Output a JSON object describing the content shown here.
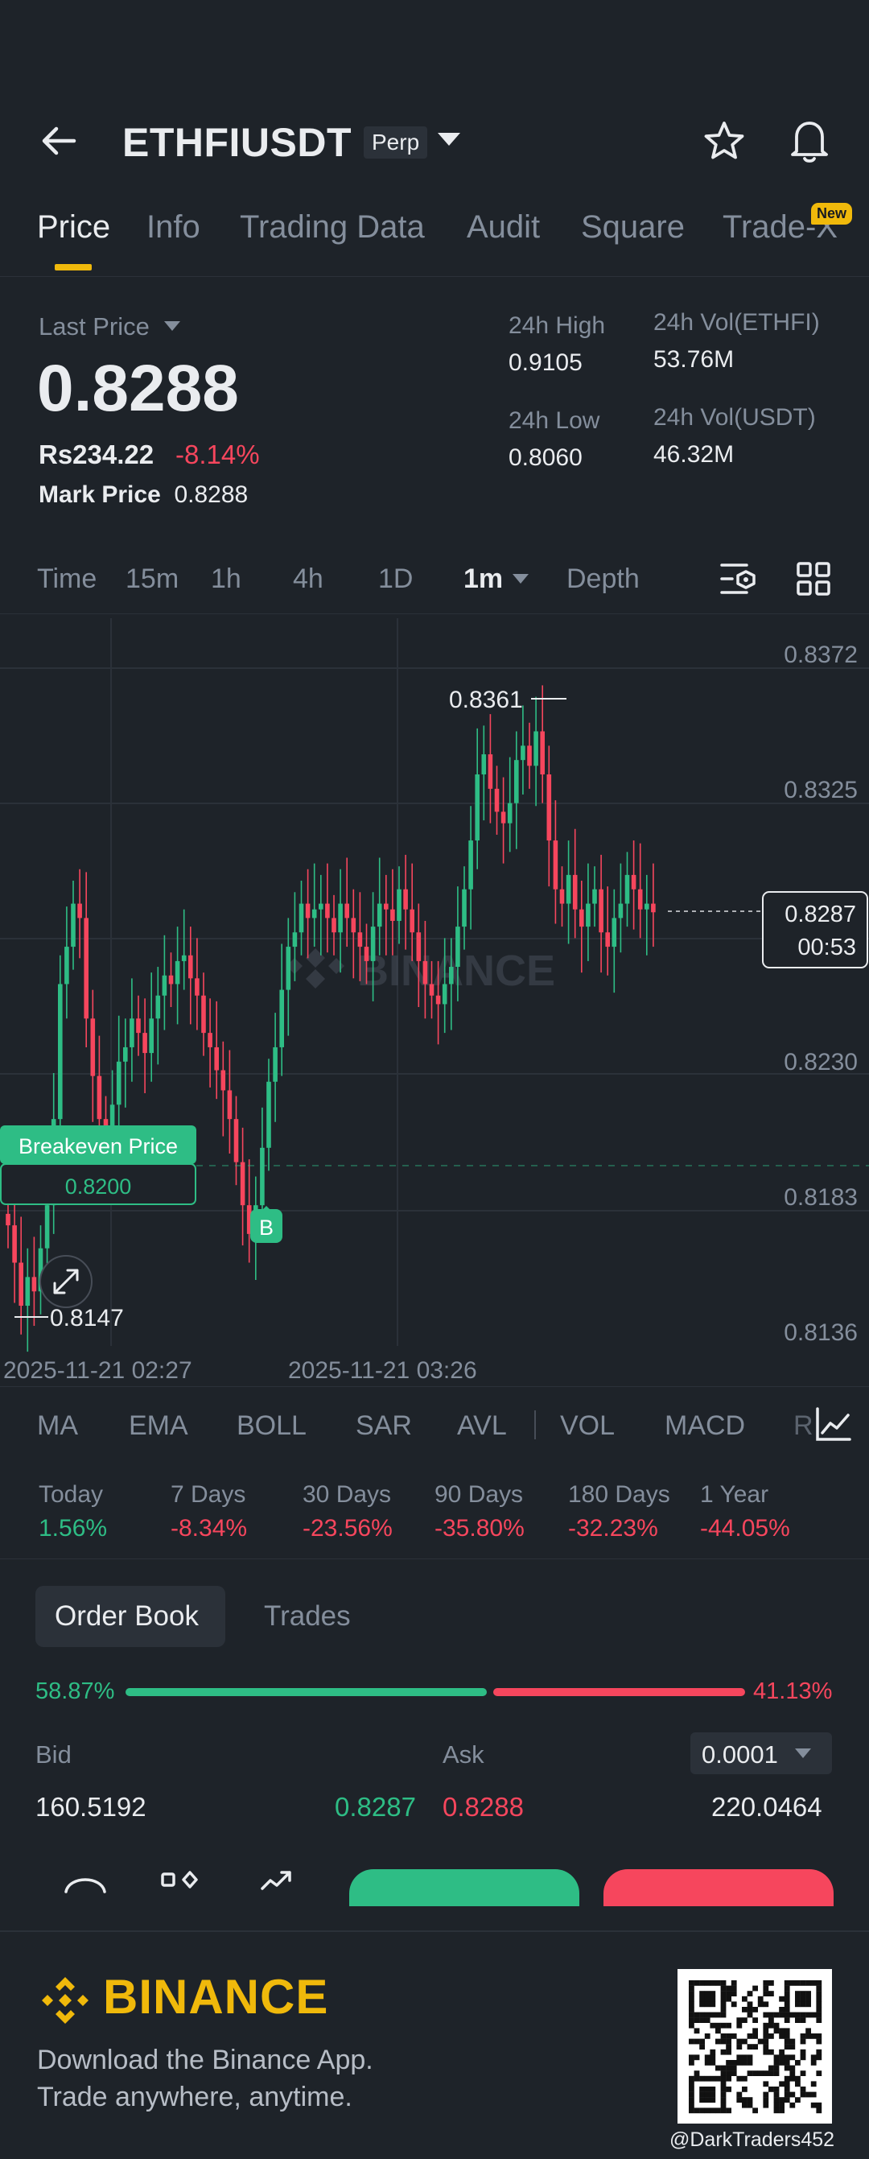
{
  "header": {
    "symbol": "ETHFIUSDT",
    "contract_type": "Perp"
  },
  "tabs": [
    {
      "label": "Price",
      "active": true
    },
    {
      "label": "Info"
    },
    {
      "label": "Trading Data"
    },
    {
      "label": "Audit"
    },
    {
      "label": "Square"
    },
    {
      "label": "Trade-X",
      "badge": "New"
    }
  ],
  "price": {
    "last_price_label": "Last Price",
    "last_price": "0.8288",
    "local_price": "Rs234.22",
    "change_pct": "-8.14%",
    "mark_price_label": "Mark Price",
    "mark_price": "0.8288"
  },
  "stats": {
    "high_label": "24h High",
    "high": "0.9105",
    "low_label": "24h Low",
    "low": "0.8060",
    "vol_base_label": "24h Vol(ETHFI)",
    "vol_base": "53.76M",
    "vol_quote_label": "24h Vol(USDT)",
    "vol_quote": "46.32M"
  },
  "intervals": [
    "Time",
    "15m",
    "1h",
    "4h",
    "1D",
    "1m",
    "Depth"
  ],
  "active_interval": "1m",
  "chart_data": {
    "type": "candlestick",
    "y_ticks": [
      "0.8372",
      "0.8325",
      "0.8230",
      "0.8183",
      "0.8136"
    ],
    "ylim": [
      0.8136,
      0.8372
    ],
    "x_ticks": [
      "2025-11-21 02:27",
      "2025-11-21 03:26"
    ],
    "high_marker": "0.8361",
    "low_marker": "0.8147",
    "current_price": "0.8287",
    "countdown": "00:53",
    "breakeven_label": "Breakeven Price",
    "breakeven_price": "0.8200",
    "buy_marker": "B",
    "watermark": "BINANCE",
    "up_color": "#2ebd85",
    "down_color": "#f6465d",
    "closes": [
      0.8178,
      0.8165,
      0.815,
      0.816,
      0.8155,
      0.817,
      0.8185,
      0.8215,
      0.8262,
      0.8275,
      0.829,
      0.8285,
      0.825,
      0.823,
      0.8215,
      0.8212,
      0.822,
      0.8235,
      0.824,
      0.825,
      0.8245,
      0.8238,
      0.825,
      0.8258,
      0.8265,
      0.8262,
      0.827,
      0.8272,
      0.8264,
      0.8258,
      0.8245,
      0.824,
      0.8232,
      0.8225,
      0.8215,
      0.82,
      0.8185,
      0.8175,
      0.8185,
      0.8205,
      0.8228,
      0.824,
      0.826,
      0.8275,
      0.828,
      0.829,
      0.8285,
      0.8288,
      0.829,
      0.8285,
      0.828,
      0.829,
      0.8285,
      0.828,
      0.8275,
      0.827,
      0.8282,
      0.829,
      0.8288,
      0.8284,
      0.8295,
      0.8288,
      0.828,
      0.827,
      0.8262,
      0.8258,
      0.8255,
      0.8262,
      0.8268,
      0.8282,
      0.8295,
      0.8312,
      0.8335,
      0.8342,
      0.833,
      0.8322,
      0.8318,
      0.8325,
      0.834,
      0.8345,
      0.8338,
      0.835,
      0.8335,
      0.8312,
      0.8295,
      0.829,
      0.83,
      0.8288,
      0.8282,
      0.829,
      0.8295,
      0.828,
      0.8275,
      0.8285,
      0.829,
      0.83,
      0.8295,
      0.8288,
      0.829,
      0.8287
    ]
  },
  "indicators": [
    "MA",
    "EMA",
    "BOLL",
    "SAR",
    "AVL",
    "VOL",
    "MACD",
    "R"
  ],
  "performance": [
    {
      "label": "Today",
      "value": "1.56%",
      "dir": "up"
    },
    {
      "label": "7 Days",
      "value": "-8.34%",
      "dir": "down"
    },
    {
      "label": "30 Days",
      "value": "-23.56%",
      "dir": "down"
    },
    {
      "label": "90 Days",
      "value": "-35.80%",
      "dir": "down"
    },
    {
      "label": "180 Days",
      "value": "-32.23%",
      "dir": "down"
    },
    {
      "label": "1 Year",
      "value": "-44.05%",
      "dir": "down"
    }
  ],
  "orderbook": {
    "tabs": [
      "Order Book",
      "Trades"
    ],
    "bid_pct": "58.87%",
    "ask_pct": "41.13%",
    "bid_ratio": 0.5887,
    "bid_label": "Bid",
    "ask_label": "Ask",
    "precision": "0.0001",
    "rows": [
      {
        "bid_qty": "160.5192",
        "bid_price": "0.8287",
        "ask_price": "0.8288",
        "ask_qty": "220.0464"
      }
    ]
  },
  "footer": {
    "brand": "BINANCE",
    "line1": "Download the Binance App.",
    "line2": "Trade anywhere, anytime.",
    "watermark": "@DarkTraders452"
  }
}
